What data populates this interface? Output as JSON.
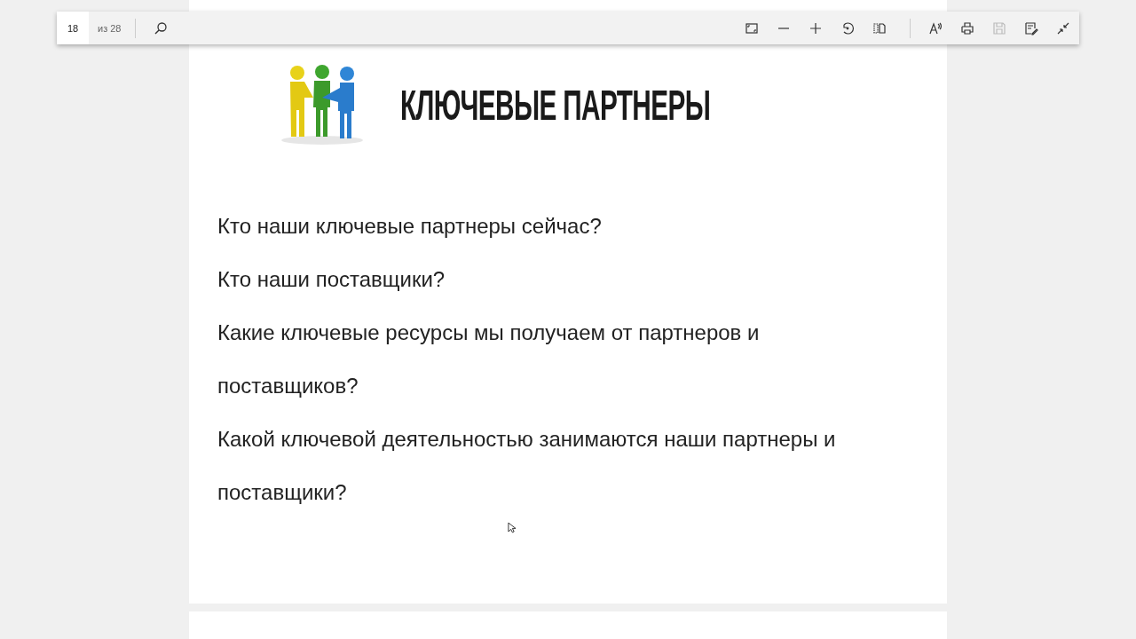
{
  "toolbar": {
    "page_number": "18",
    "page_total": "из 28",
    "tools": [
      {
        "kind": "fit",
        "disabled": false
      },
      {
        "kind": "zoom-out",
        "disabled": false
      },
      {
        "kind": "zoom-in",
        "disabled": false
      },
      {
        "kind": "rotate",
        "disabled": false
      },
      {
        "kind": "two-page",
        "disabled": false
      },
      {
        "kind": "read-aloud",
        "disabled": false
      },
      {
        "kind": "print",
        "disabled": false
      },
      {
        "kind": "save",
        "disabled": true
      },
      {
        "kind": "annotate",
        "disabled": false
      },
      {
        "kind": "exit-fullscreen",
        "disabled": false
      }
    ]
  },
  "slide": {
    "title": "КЛЮЧЕВЫЕ ПАРТНЕРЫ",
    "questions": [
      "Кто наши ключевые партнеры сейчас?",
      "Кто наши поставщики?",
      "Какие ключевые ресурсы мы получаем от партнеров и поставщиков?",
      "Какой ключевой деятельностью занимаются наши партнеры и поставщики?"
    ]
  }
}
